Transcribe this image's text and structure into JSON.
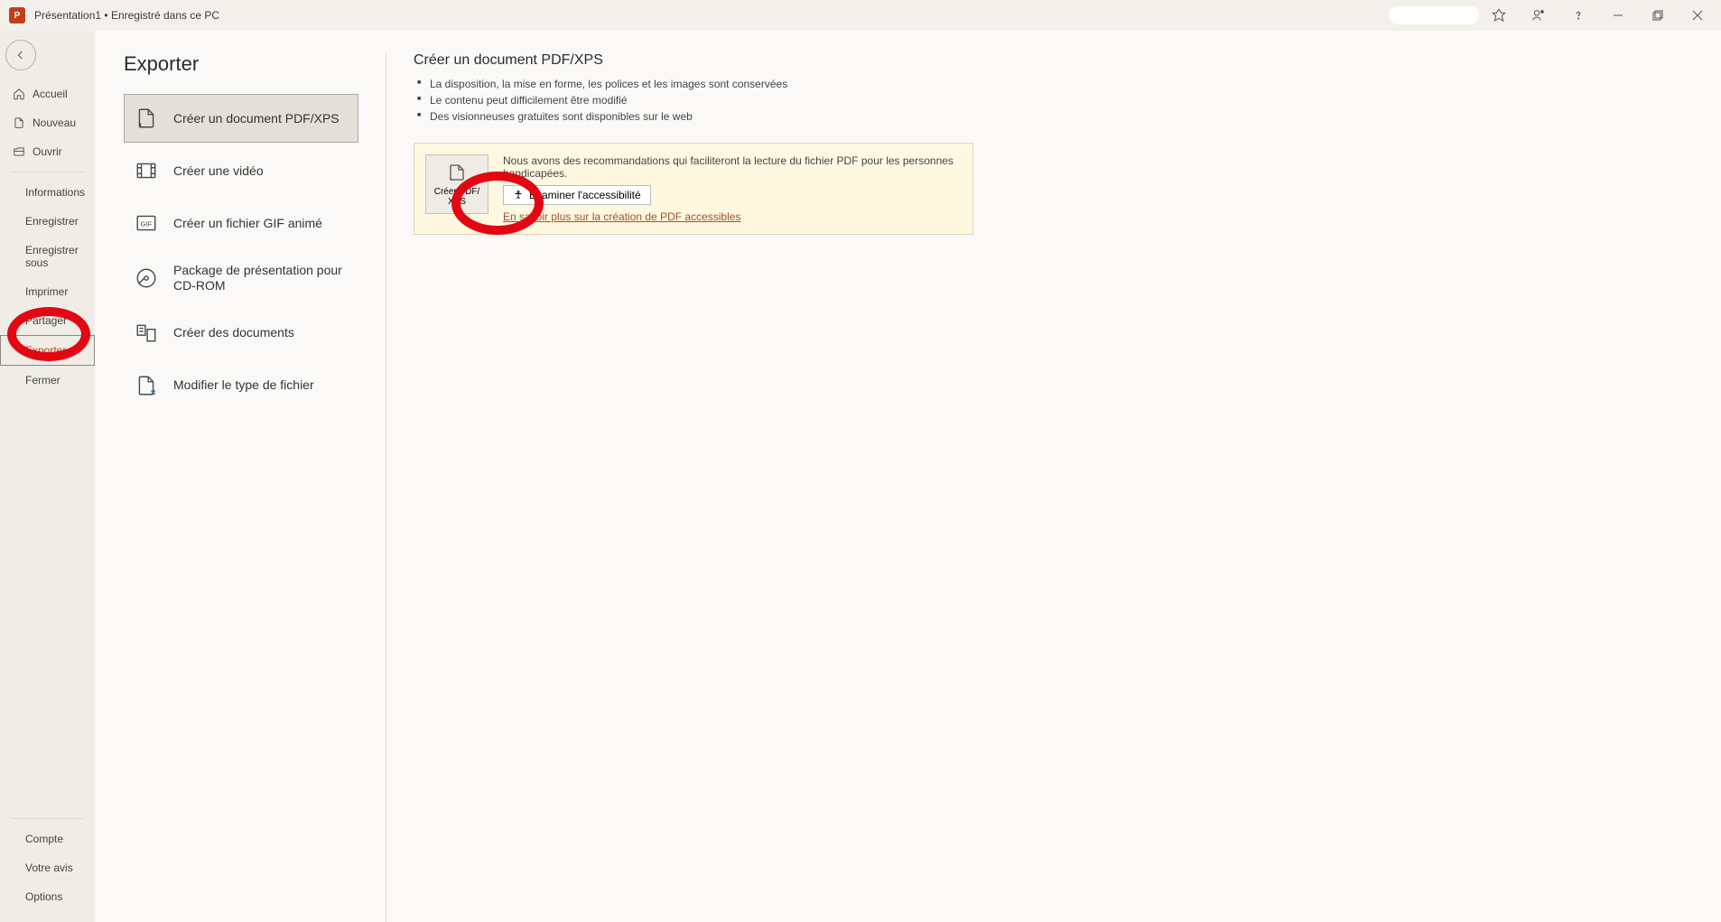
{
  "titlebar": {
    "app_letter": "P",
    "doc_name": "Présentation1",
    "save_state": "Enregistré dans ce PC"
  },
  "sidebar": {
    "home": "Accueil",
    "new": "Nouveau",
    "open": "Ouvrir",
    "info": "Informations",
    "save": "Enregistrer",
    "saveas": "Enregistrer sous",
    "print": "Imprimer",
    "share": "Partager",
    "export": "Exporter",
    "close": "Fermer",
    "account": "Compte",
    "feedback": "Votre avis",
    "options": "Options"
  },
  "page": {
    "title": "Exporter"
  },
  "export_options": {
    "pdf": "Créer un document PDF/XPS",
    "video": "Créer une vidéo",
    "gif": "Créer un fichier GIF animé",
    "cdrom": "Package de présentation pour CD-ROM",
    "handouts": "Créer des documents",
    "filetype": "Modifier le type de fichier"
  },
  "detail": {
    "heading": "Créer un document PDF/XPS",
    "bullets": [
      "La disposition, la mise en forme, les polices et les images sont conservées",
      "Le contenu peut difficilement être modifié",
      "Des visionneuses gratuites sont disponibles sur le web"
    ],
    "create_btn_line1": "Créer PDF/",
    "create_btn_line2": "XPS",
    "info_text": "Nous avons des recommandations qui faciliteront la lecture du fichier PDF pour les personnes handicapées.",
    "examine_btn": "Examiner l'accessibilité",
    "learn_more": "En savoir plus sur la création de PDF accessibles"
  }
}
